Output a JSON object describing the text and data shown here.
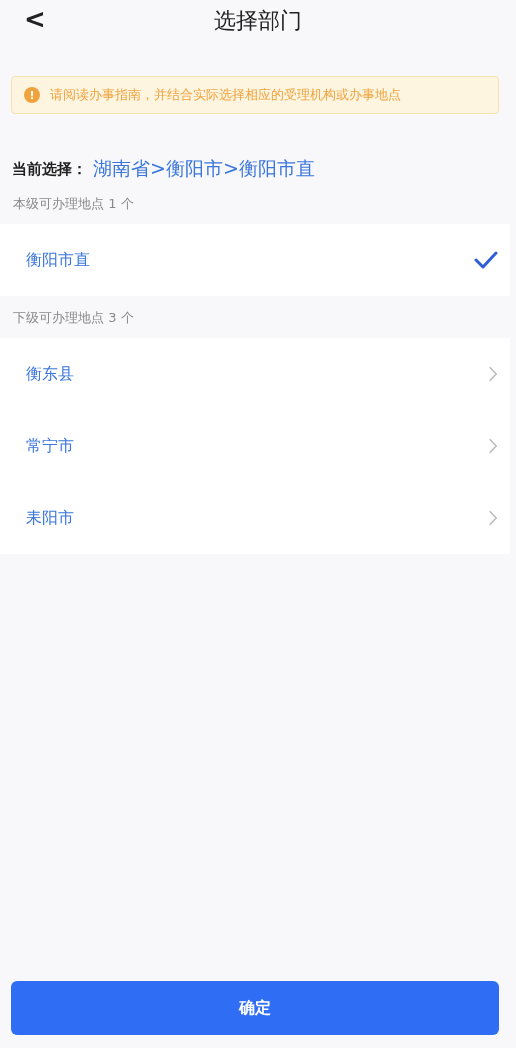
{
  "header": {
    "back": "<",
    "title": "选择部门"
  },
  "notice": {
    "icon": "!",
    "text": "请阅读办事指南，并结合实际选择相应的受理机构或办事地点"
  },
  "current": {
    "label": "当前选择：",
    "value": "湖南省>衡阳市>衡阳市直"
  },
  "sections": [
    {
      "label": "本级可办理地点 1 个",
      "items": [
        {
          "name": "衡阳市直",
          "kind": "pick",
          "selected": true
        }
      ]
    },
    {
      "label": "下级可办理地点 3 个",
      "items": [
        {
          "name": "衡东县",
          "kind": "drill"
        },
        {
          "name": "常宁市",
          "kind": "drill"
        },
        {
          "name": "耒阳市",
          "kind": "drill"
        }
      ]
    }
  ],
  "confirm": "确定"
}
